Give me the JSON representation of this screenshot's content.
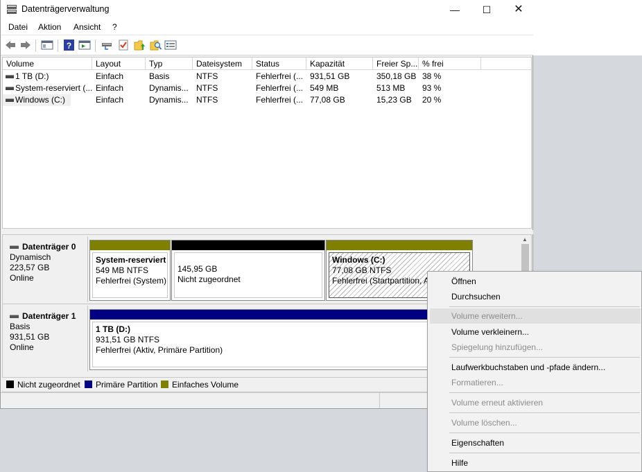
{
  "window": {
    "title": "Datenträgerverwaltung",
    "minimize": "—",
    "maximize": "☐",
    "close": "✕"
  },
  "menu": [
    "Datei",
    "Aktion",
    "Ansicht",
    "?"
  ],
  "toolbar_icons": [
    "back-arrow-icon",
    "forward-arrow-icon",
    "console-view-icon",
    "help-icon",
    "action-pane-icon",
    "drive-connect-icon",
    "check-icon",
    "folder-up-icon",
    "search-folder-icon",
    "properties-list-icon"
  ],
  "volumes": {
    "columns": [
      "Volume",
      "Layout",
      "Typ",
      "Dateisystem",
      "Status",
      "Kapazität",
      "Freier Sp...",
      "% frei"
    ],
    "rows": [
      [
        "1 TB (D:)",
        "Einfach",
        "Basis",
        "NTFS",
        "Fehlerfrei (...",
        "931,51 GB",
        "350,18 GB",
        "38 %"
      ],
      [
        "System-reserviert (...",
        "Einfach",
        "Dynamis...",
        "NTFS",
        "Fehlerfrei (...",
        "549 MB",
        "513 MB",
        "93 %"
      ],
      [
        "Windows (C:)",
        "Einfach",
        "Dynamis...",
        "NTFS",
        "Fehlerfrei (...",
        "77,08 GB",
        "15,23 GB",
        "20 %"
      ]
    ]
  },
  "disks": [
    {
      "name": "Datenträger 0",
      "type": "Dynamisch",
      "size": "223,57 GB",
      "state": "Online",
      "partitions": [
        {
          "title": "System-reserviert",
          "line1": "549 MB NTFS",
          "line2": "Fehlerfrei (System)"
        },
        {
          "title": "",
          "line1": "145,95 GB",
          "line2": "Nicht zugeordnet"
        },
        {
          "title": "Windows  (C:)",
          "line1": "77,08 GB NTFS",
          "line2": "Fehlerfrei (Startpartition, A"
        }
      ]
    },
    {
      "name": "Datenträger 1",
      "type": "Basis",
      "size": "931,51 GB",
      "state": "Online",
      "partitions": [
        {
          "title": "1 TB  (D:)",
          "line1": "931,51 GB NTFS",
          "line2": "Fehlerfrei (Aktiv, Primäre Partition)"
        }
      ]
    }
  ],
  "legend": [
    {
      "label": "Nicht zugeordnet",
      "color": "#000000"
    },
    {
      "label": "Primäre Partition",
      "color": "#000080"
    },
    {
      "label": "Einfaches Volume",
      "color": "#808000"
    }
  ],
  "context_menu": [
    {
      "label": "Öffnen",
      "disabled": false
    },
    {
      "label": "Durchsuchen",
      "disabled": false
    },
    {
      "label": "Volume erweitern...",
      "disabled": true
    },
    {
      "label": "Volume verkleinern...",
      "disabled": false
    },
    {
      "label": "Spiegelung hinzufügen...",
      "disabled": true
    },
    {
      "label": "Laufwerkbuchstaben und -pfade ändern...",
      "disabled": false
    },
    {
      "label": "Formatieren...",
      "disabled": true
    },
    {
      "label": "Volume erneut aktivieren",
      "disabled": true
    },
    {
      "label": "Volume löschen...",
      "disabled": true
    },
    {
      "label": "Eigenschaften",
      "disabled": false
    },
    {
      "label": "Hilfe",
      "disabled": false
    }
  ]
}
